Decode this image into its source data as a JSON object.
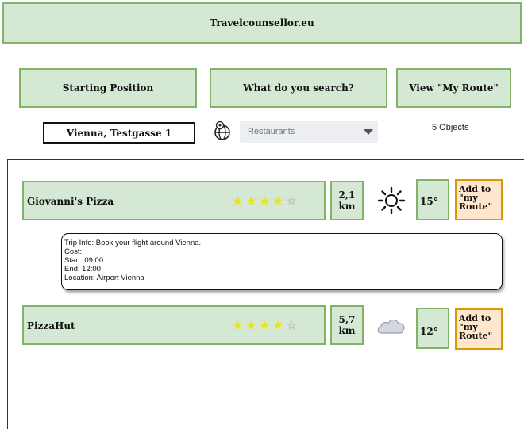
{
  "header": {
    "title": "Travelcounsellor.eu"
  },
  "nav": {
    "starting_position": "Starting Position",
    "search": "What do you search?",
    "view_route": "View \"My Route\""
  },
  "controls": {
    "location_value": "Vienna, Testgasse 1",
    "category_selected": "Restaurants",
    "objects_count": "5 Objects"
  },
  "results": [
    {
      "name": "Giovanni's Pizza",
      "rating": 4,
      "rating_max": 5,
      "distance": "2,1 km",
      "weather_icon": "sun-icon",
      "temperature": "15°",
      "add_label": "Add to \"my Route\""
    },
    {
      "name": "PizzaHut",
      "rating": 4,
      "rating_max": 5,
      "distance": "5,7 km",
      "weather_icon": "cloud-icon",
      "temperature": "12°",
      "add_label": "Add to \"my Route\""
    }
  ],
  "trip_info": {
    "line1": "Trip Info: Book your flight around Vienna.",
    "line2": "Cost:",
    "line3": "Start: 09:00",
    "line4": "End: 12:00",
    "line5": "Location: Airport Vienna"
  },
  "colors": {
    "green_fill": "#d5e8d4",
    "green_border": "#82b366",
    "orange_fill": "#ffe6cc",
    "orange_border": "#d79b00",
    "star_on": "#e8e31c"
  }
}
